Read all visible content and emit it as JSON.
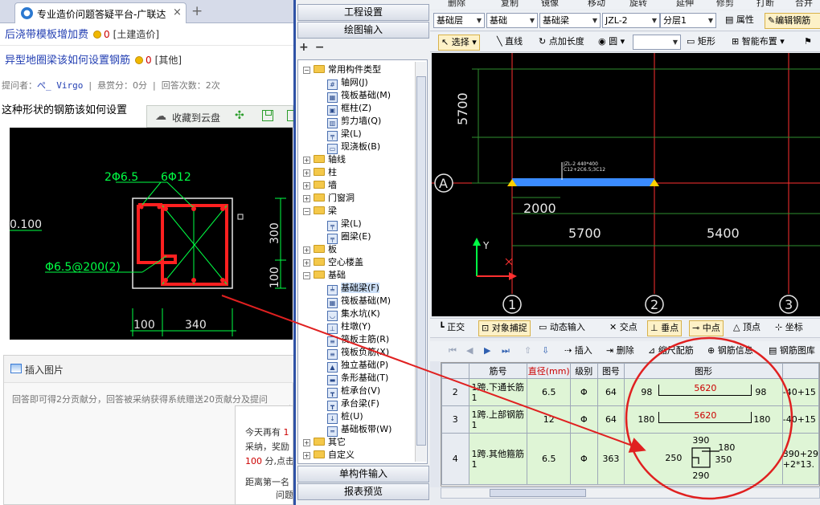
{
  "browser": {
    "tab_title": "专业造价问题答疑平台-广联达",
    "tab_close": "×",
    "new_tab": "+",
    "q1_title": "后浇带模板增加费",
    "q1_score": "0",
    "q1_category": "[土建造价]",
    "q2_title": "异型地圈梁该如何设置钢筋",
    "q2_score": "0",
    "q2_category": "[其他]",
    "asker_label": "提问者：",
    "asker_name": "ぺ_ Virgo",
    "reward": "悬赏分：0分",
    "answers": "回答次数：2次",
    "question_text": "这种形状的钢筋该如何设置",
    "cloud_save": "收藏到云盘",
    "insert_image": "插入图片",
    "answer_placeholder": "回答即可得2分贡献分，回答被采纳获得系统赠送20贡献分及提问",
    "tip_line1": "今天再有",
    "tip_num1": "1",
    "tip_line2": "采纳，奖励",
    "tip_num2": "100",
    "tip_line3": " 分,点击",
    "tip_line4": "距离第一名",
    "tip_line5": "问题"
  },
  "drawing_image": {
    "label_2phi65": "2Φ6.5",
    "label_6phi12": "6Φ12",
    "label_0100": "0.100",
    "label_stirrup": "Φ6.5@200(2)",
    "dim_300": "300",
    "dim_100v": "100",
    "dim_100h": "100",
    "dim_340": "340"
  },
  "tree": {
    "top_buttons": [
      "工程设置",
      "绘图输入"
    ],
    "bottom_buttons": [
      "单构件输入",
      "报表预览"
    ],
    "add_glyph": "+",
    "remove_glyph": "−",
    "nodes": [
      {
        "label": "常用构件类型",
        "kind": "folder",
        "expand": "−"
      },
      {
        "label": "轴网(J)",
        "kind": "item",
        "glyph": "#"
      },
      {
        "label": "筏板基础(M)",
        "kind": "item",
        "glyph": "▦"
      },
      {
        "label": "框柱(Z)",
        "kind": "item",
        "glyph": "▣"
      },
      {
        "label": "剪力墙(Q)",
        "kind": "item",
        "glyph": "▥"
      },
      {
        "label": "梁(L)",
        "kind": "item",
        "glyph": "╤"
      },
      {
        "label": "现浇板(B)",
        "kind": "item",
        "glyph": "▭"
      },
      {
        "label": "轴线",
        "kind": "folder",
        "expand": "+"
      },
      {
        "label": "柱",
        "kind": "folder",
        "expand": "+"
      },
      {
        "label": "墙",
        "kind": "folder",
        "expand": "+"
      },
      {
        "label": "门窗洞",
        "kind": "folder",
        "expand": "+"
      },
      {
        "label": "梁",
        "kind": "folder",
        "expand": "−"
      },
      {
        "label": "梁(L)",
        "kind": "item",
        "glyph": "╤"
      },
      {
        "label": "圈梁(E)",
        "kind": "item",
        "glyph": "╤"
      },
      {
        "label": "板",
        "kind": "folder",
        "expand": "+"
      },
      {
        "label": "空心楼盖",
        "kind": "folder",
        "expand": "+"
      },
      {
        "label": "基础",
        "kind": "folder",
        "expand": "−"
      },
      {
        "label": "基础梁(F)",
        "kind": "item",
        "glyph": "╧",
        "selected": true
      },
      {
        "label": "筏板基础(M)",
        "kind": "item",
        "glyph": "▦"
      },
      {
        "label": "集水坑(K)",
        "kind": "item",
        "glyph": "◡"
      },
      {
        "label": "柱墩(Y)",
        "kind": "item",
        "glyph": "⊥"
      },
      {
        "label": "筏板主筋(R)",
        "kind": "item",
        "glyph": "≡"
      },
      {
        "label": "筏板负筋(X)",
        "kind": "item",
        "glyph": "≡"
      },
      {
        "label": "独立基础(P)",
        "kind": "item",
        "glyph": "▲"
      },
      {
        "label": "条形基础(T)",
        "kind": "item",
        "glyph": "▬"
      },
      {
        "label": "桩承台(V)",
        "kind": "item",
        "glyph": "┳"
      },
      {
        "label": "承台梁(F)",
        "kind": "item",
        "glyph": "┳"
      },
      {
        "label": "桩(U)",
        "kind": "item",
        "glyph": "↓"
      },
      {
        "label": "基础板带(W)",
        "kind": "item",
        "glyph": "═"
      },
      {
        "label": "其它",
        "kind": "folder",
        "expand": "+"
      },
      {
        "label": "自定义",
        "kind": "folder",
        "expand": "+"
      }
    ]
  },
  "cad": {
    "menu_items": [
      "删除",
      "复制",
      "镜像",
      "移动",
      "旋转",
      "延伸",
      "修剪",
      "打断",
      "合并"
    ],
    "combo_floor": "基础层",
    "combo_type": "基础",
    "combo_member": "基础梁",
    "combo_name": "JZL-2",
    "combo_layer": "分层1",
    "btn_props": "属性",
    "btn_edit_rebar": "编辑钢筋",
    "btn_select": "选择",
    "btn_line": "直线",
    "btn_point_len": "点加长度",
    "btn_circle": "圆",
    "btn_rect": "矩形",
    "btn_smart": "智能布置",
    "snap_ortho": "正交",
    "snap_object": "对象捕捉",
    "snap_dynamic": "动态输入",
    "snap_intersection": "交点",
    "snap_perp": "垂点",
    "snap_mid": "中点",
    "snap_vertex": "顶点",
    "snap_coord": "坐标",
    "grid_insert": "插入",
    "grid_delete": "删除",
    "grid_scale": "缩尺配筋",
    "grid_info": "钢筋信息",
    "grid_lib": "钢筋图库",
    "canvas_5700v": "5700",
    "canvas_2000": "2000",
    "canvas_5700h": "5700",
    "canvas_5400": "5400",
    "axis_A": "A",
    "axis_1": "1",
    "axis_2": "2",
    "axis_3": "3",
    "y_label": "Y",
    "beam_label1": "JZL-2 440*400",
    "beam_label2": "C12+2C6.5;3C12",
    "table_headers": [
      "筋号",
      "直径(mm)",
      "级别",
      "图号",
      "图形"
    ],
    "rows": [
      {
        "idx": "2",
        "name": "1跨.下通长筋1",
        "dia": "6.5",
        "grade": "Φ",
        "fig": "64",
        "left": "98",
        "mid": "5620",
        "right": "98",
        "extra": "-40+15"
      },
      {
        "idx": "3",
        "name": "1跨.上部钢筋1",
        "dia": "12",
        "grade": "Φ",
        "fig": "64",
        "left": "180",
        "mid": "5620",
        "right": "180",
        "extra": "-40+15"
      },
      {
        "idx": "4",
        "name": "1跨.其他箍筋1",
        "dia": "6.5",
        "grade": "Φ",
        "fig": "363",
        "extra": "390+29 +2*13."
      }
    ],
    "stirrup_390": "390",
    "stirrup_180": "180",
    "stirrup_250": "250",
    "stirrup_350": "350",
    "stirrup_290": "290"
  }
}
